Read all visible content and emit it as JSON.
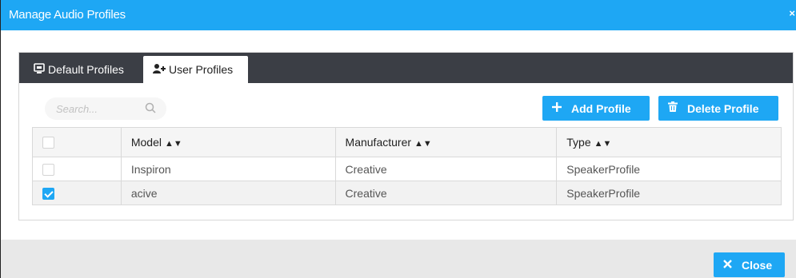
{
  "dialog": {
    "title": "Manage Audio Profiles",
    "close_x": "×"
  },
  "tabs": [
    {
      "label": "Default Profiles",
      "icon": "monitor-icon",
      "active": false
    },
    {
      "label": "User Profiles",
      "icon": "add-user-icon",
      "active": true
    }
  ],
  "toolbar": {
    "search_placeholder": "Search...",
    "add_label": "Add Profile",
    "delete_label": "Delete Profile"
  },
  "table": {
    "columns": [
      "Model",
      "Manufacturer",
      "Type"
    ],
    "sort_glyph": "▲▼",
    "rows": [
      {
        "checked": false,
        "model": "Inspiron",
        "manufacturer": "Creative",
        "type": "SpeakerProfile"
      },
      {
        "checked": true,
        "model": "acive",
        "manufacturer": "Creative",
        "type": "SpeakerProfile"
      }
    ]
  },
  "footer": {
    "close_label": "Close"
  },
  "colors": {
    "accent": "#1ea7f4",
    "tabbar": "#3b3e45"
  }
}
